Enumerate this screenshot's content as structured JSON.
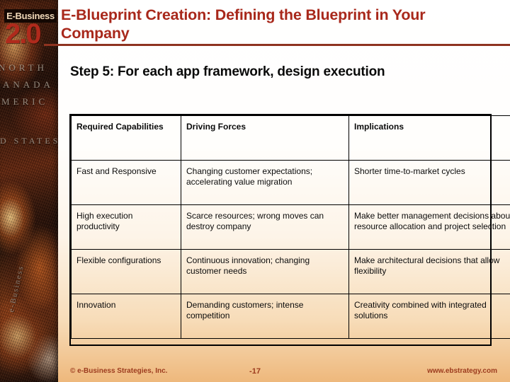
{
  "logo": {
    "brand": "E-Business",
    "version": "2.0",
    "spine_words": [
      "NORTH",
      "ANADA",
      "MERIC",
      "D STATES",
      "e-Business"
    ]
  },
  "header": {
    "title": "E-Blueprint Creation: Defining the Blueprint in Your Company",
    "rule_color": "#8e3320",
    "title_color": "#a8281b"
  },
  "subtitle": "Step 5: For each app framework, design execution",
  "table": {
    "columns": [
      "Required Capabilities",
      "Driving Forces",
      "Implications"
    ],
    "rows": [
      {
        "capability": "Fast and Responsive",
        "driving_forces": "Changing customer expectations; accelerating value migration",
        "implications": "Shorter time-to-market cycles"
      },
      {
        "capability": "High execution productivity",
        "driving_forces": "Scarce resources; wrong moves can destroy company",
        "implications": "Make better management decisions about resource allocation and project selection"
      },
      {
        "capability": "Flexible configurations",
        "driving_forces": "Continuous innovation; changing customer needs",
        "implications": "Make architectural decisions that allow flexibility"
      },
      {
        "capability": "Innovation",
        "driving_forces": "Demanding customers; intense competition",
        "implications": "Creativity combined with integrated solutions"
      }
    ]
  },
  "footer": {
    "copyright": "© e-Business Strategies, Inc.",
    "page_number": "-17",
    "url": "www.ebstrategy.com",
    "text_color": "#9c3b1e"
  }
}
